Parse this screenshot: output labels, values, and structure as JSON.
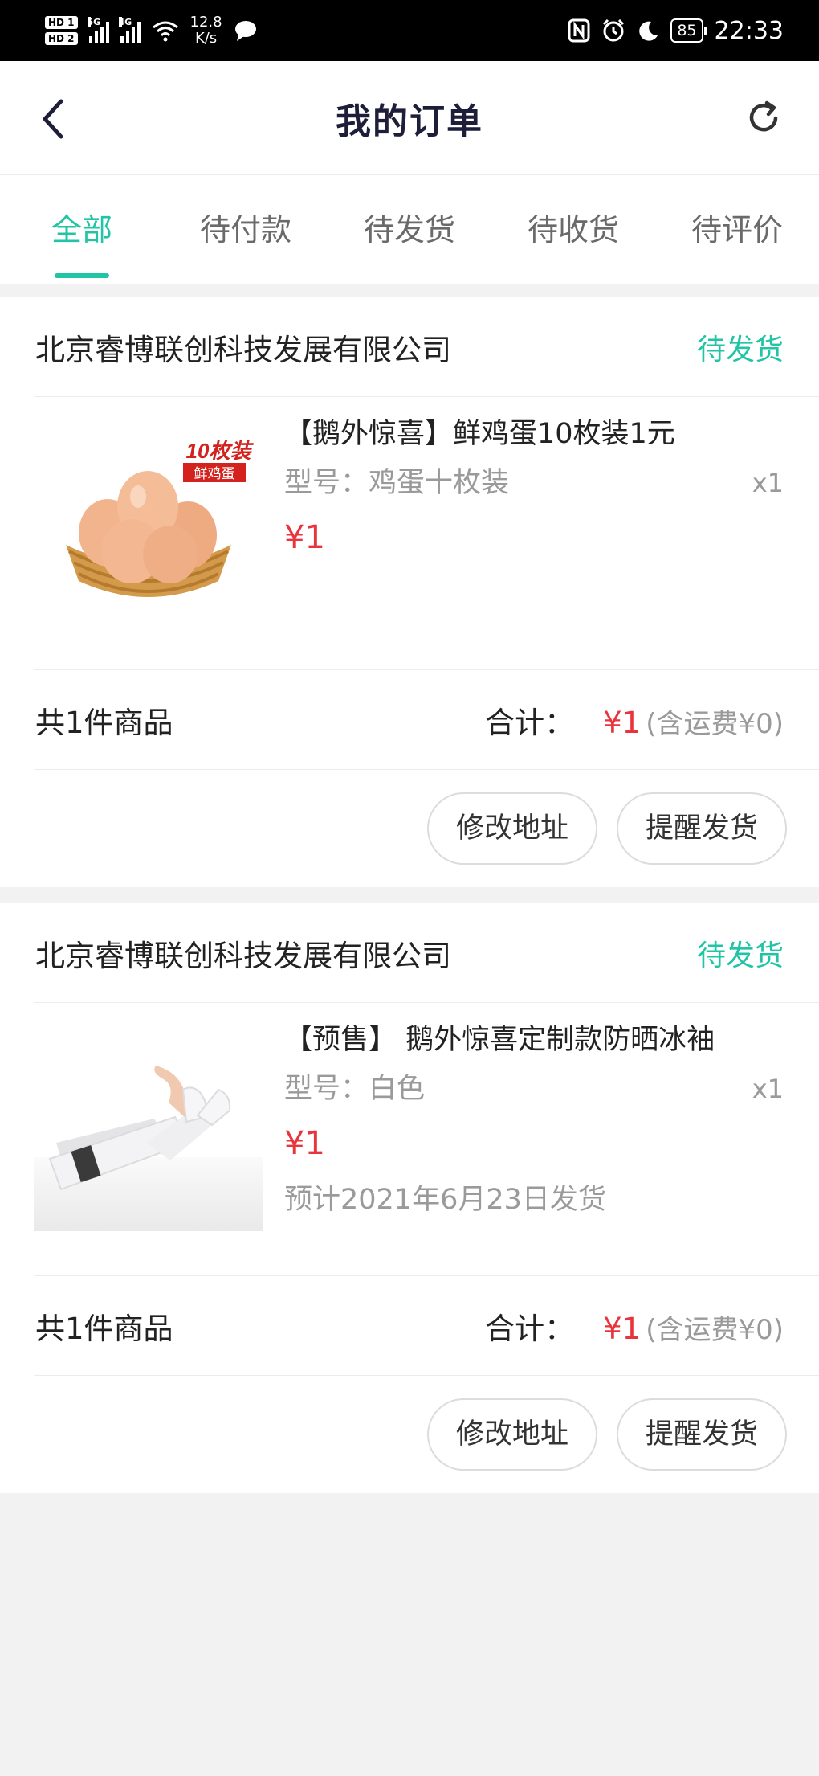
{
  "status_bar": {
    "hd1": "HD 1",
    "hd2": "HD 2",
    "sig1_tag": "5G",
    "sig2_tag": "4G",
    "speed_value": "12.8",
    "speed_unit": "K/s",
    "battery": "85",
    "time": "22:33",
    "icons": [
      "nfc-icon",
      "alarm-icon",
      "moon-icon",
      "chat-bubble-icon",
      "wifi-icon"
    ]
  },
  "header": {
    "title": "我的订单",
    "back_icon": "chevron-left-icon",
    "refresh_icon": "refresh-icon"
  },
  "tabs": [
    {
      "label": "全部",
      "active": true
    },
    {
      "label": "待付款",
      "active": false
    },
    {
      "label": "待发货",
      "active": false
    },
    {
      "label": "待收货",
      "active": false
    },
    {
      "label": "待评价",
      "active": false
    }
  ],
  "orders": [
    {
      "shop": "北京睿博联创科技发展有限公司",
      "status": "待发货",
      "product": {
        "title": "【鹅外惊喜】鲜鸡蛋10枚装1元",
        "spec": "型号：鸡蛋十枚装",
        "qty": "x1",
        "price": "¥1",
        "ship_note": "",
        "image_badge_top": "10枚装",
        "image_badge_bottom": "鲜鸡蛋"
      },
      "summary": {
        "count": "共1件商品",
        "total_label": "合计：",
        "total": "¥1",
        "shipping": "(含运费¥0)"
      },
      "actions": [
        "修改地址",
        "提醒发货"
      ]
    },
    {
      "shop": "北京睿博联创科技发展有限公司",
      "status": "待发货",
      "product": {
        "title": "【预售】 鹅外惊喜定制款防晒冰袖",
        "spec": "型号：白色",
        "qty": "x1",
        "price": "¥1",
        "ship_note": "预计2021年6月23日发货",
        "image_badge_top": "",
        "image_badge_bottom": ""
      },
      "summary": {
        "count": "共1件商品",
        "total_label": "合计：",
        "total": "¥1",
        "shipping": "(含运费¥0)"
      },
      "actions": [
        "修改地址",
        "提醒发货"
      ]
    }
  ],
  "colors": {
    "accent": "#22c4a6",
    "price": "#e8343c",
    "muted": "#9a9a9a",
    "background": "#f2f2f2"
  }
}
